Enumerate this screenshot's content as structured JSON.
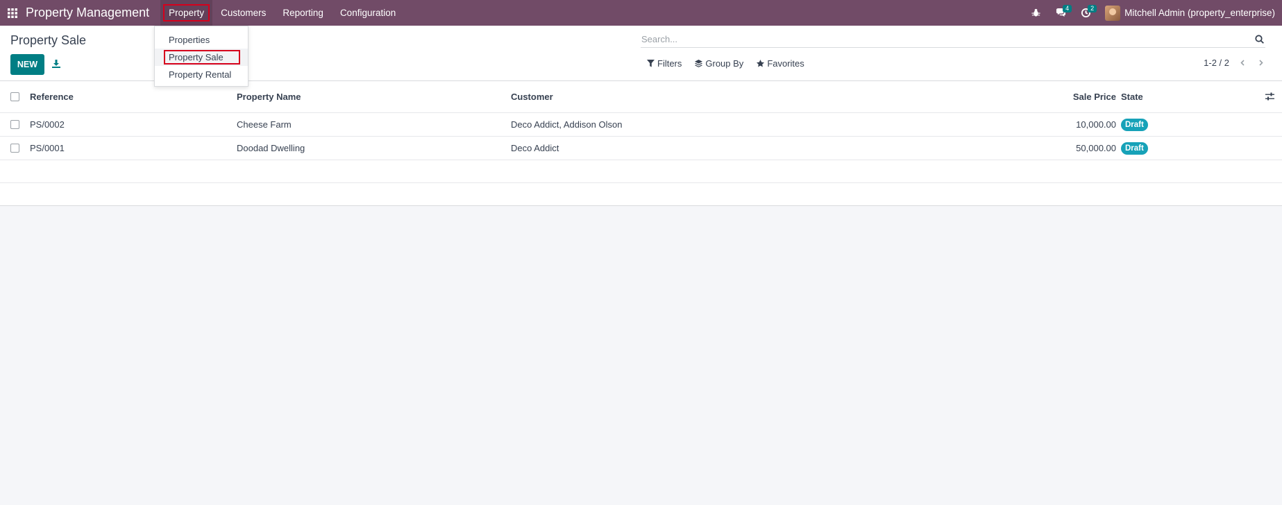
{
  "navbar": {
    "apps_icon": "apps-grid-icon",
    "brand": "Property Management",
    "menu": [
      {
        "label": "Property",
        "active": true
      },
      {
        "label": "Customers"
      },
      {
        "label": "Reporting"
      },
      {
        "label": "Configuration"
      }
    ],
    "messages_badge": "4",
    "activities_badge": "2",
    "user_name": "Mitchell Admin (property_enterprise)"
  },
  "dropdown": {
    "items": [
      "Properties",
      "Property Sale",
      "Property Rental"
    ],
    "selected_index": 1
  },
  "control_panel": {
    "title": "Property Sale",
    "new_label": "NEW",
    "search_placeholder": "Search...",
    "filters_label": "Filters",
    "group_by_label": "Group By",
    "favorites_label": "Favorites",
    "pager": "1-2 / 2"
  },
  "table": {
    "headers": {
      "reference": "Reference",
      "property_name": "Property Name",
      "customer": "Customer",
      "sale_price": "Sale Price",
      "state": "State"
    },
    "rows": [
      {
        "reference": "PS/0002",
        "property_name": "Cheese Farm",
        "customer": "Deco Addict, Addison Olson",
        "sale_price": "10,000.00",
        "state": "Draft"
      },
      {
        "reference": "PS/0001",
        "property_name": "Doodad Dwelling",
        "customer": "Deco Addict",
        "sale_price": "50,000.00",
        "state": "Draft"
      }
    ]
  },
  "colors": {
    "navbar": "#714b67",
    "primary": "#017e84",
    "state_badge": "#17a2b8",
    "highlight": "#d6001c"
  }
}
